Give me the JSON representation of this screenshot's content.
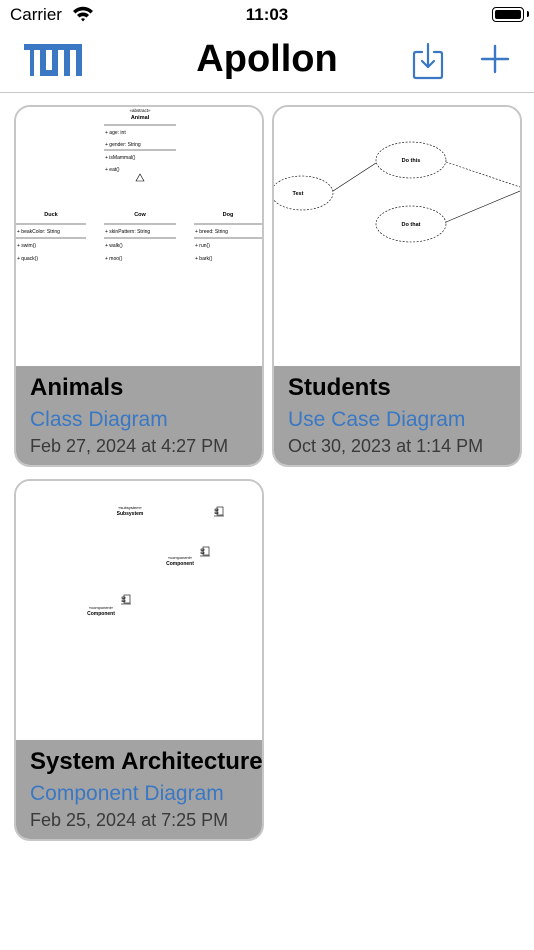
{
  "status_bar": {
    "carrier": "Carrier",
    "time": "11:03"
  },
  "nav": {
    "title": "Apollon",
    "logo_icon": "tum-logo-icon",
    "import_icon": "import-icon",
    "add_icon": "plus-icon"
  },
  "colors": {
    "accent": "#3a78c4",
    "card_footer": "#a3a3a3"
  },
  "diagrams": [
    {
      "title": "Animals",
      "type": "Class Diagram",
      "date": "Feb 27, 2024 at 4:27 PM",
      "preview": {
        "main_class": {
          "stereotype": "«abstract»",
          "name": "Animal",
          "attributes": [
            "+ age: int",
            "+ gender: String"
          ],
          "methods": [
            "+ isMammal()",
            "+ eat()"
          ]
        },
        "subclasses": [
          {
            "name": "Duck",
            "attributes": [
              "+ beakColor: String"
            ],
            "methods": [
              "+ swim()",
              "+ quack()"
            ]
          },
          {
            "name": "Cow",
            "attributes": [
              "+ skinPattern: String"
            ],
            "methods": [
              "+ walk()",
              "+ moo()"
            ]
          },
          {
            "name": "Dog",
            "attributes": [
              "+ breed: String"
            ],
            "methods": [
              "+ run()",
              "+ bark()"
            ]
          }
        ]
      }
    },
    {
      "title": "Students",
      "type": "Use Case Diagram",
      "date": "Oct 30, 2023 at 1:14 PM",
      "preview": {
        "use_cases": [
          "Test",
          "Do this",
          "Do that"
        ]
      }
    },
    {
      "title": "System Architecture",
      "type": "Component Diagram",
      "date": "Feb 25, 2024 at 7:25 PM",
      "preview": {
        "elements": [
          {
            "stereotype": "«subsystem»",
            "name": "Subsystem"
          },
          {
            "stereotype": "«component»",
            "name": "Component"
          },
          {
            "stereotype": "«component»",
            "name": "Component"
          }
        ]
      }
    }
  ]
}
